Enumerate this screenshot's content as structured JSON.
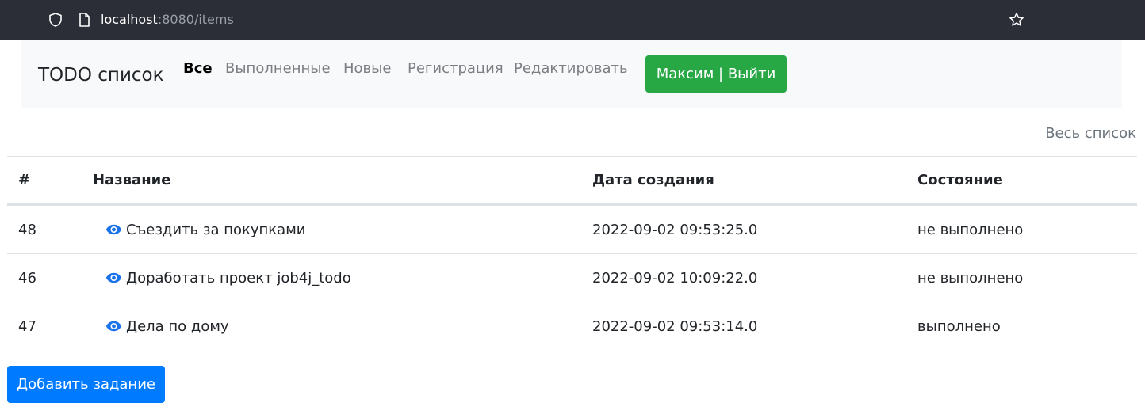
{
  "browser": {
    "url_host": "localhost",
    "url_rest": ":8080/items",
    "icons": [
      "shield-icon",
      "page-icon",
      "star-icon"
    ]
  },
  "navbar": {
    "brand": "TODO список",
    "links": [
      "Все",
      "Выполненные",
      "Новые",
      "Регистрация",
      "Редактировать"
    ],
    "user_button": "Максим | Выйти"
  },
  "all_list_link": "Весь список",
  "table": {
    "headers": [
      "#",
      "Название",
      "Дата создания",
      "Состояние"
    ],
    "rows": [
      {
        "id": "48",
        "name": "Съездить за покупками",
        "created": "2022-09-02 09:53:25.0",
        "state": "не выполнено"
      },
      {
        "id": "46",
        "name": "Доработать проект job4j_todo",
        "created": "2022-09-02 10:09:22.0",
        "state": "не выполнено"
      },
      {
        "id": "47",
        "name": "Дела по дому",
        "created": "2022-09-02 09:53:14.0",
        "state": "выполнено"
      }
    ]
  },
  "add_button": "Добавить задание",
  "colors": {
    "success": "#28a745",
    "primary": "#007bff",
    "browser_bar": "#2b2e37",
    "navbar_bg": "#f8f9fa"
  }
}
